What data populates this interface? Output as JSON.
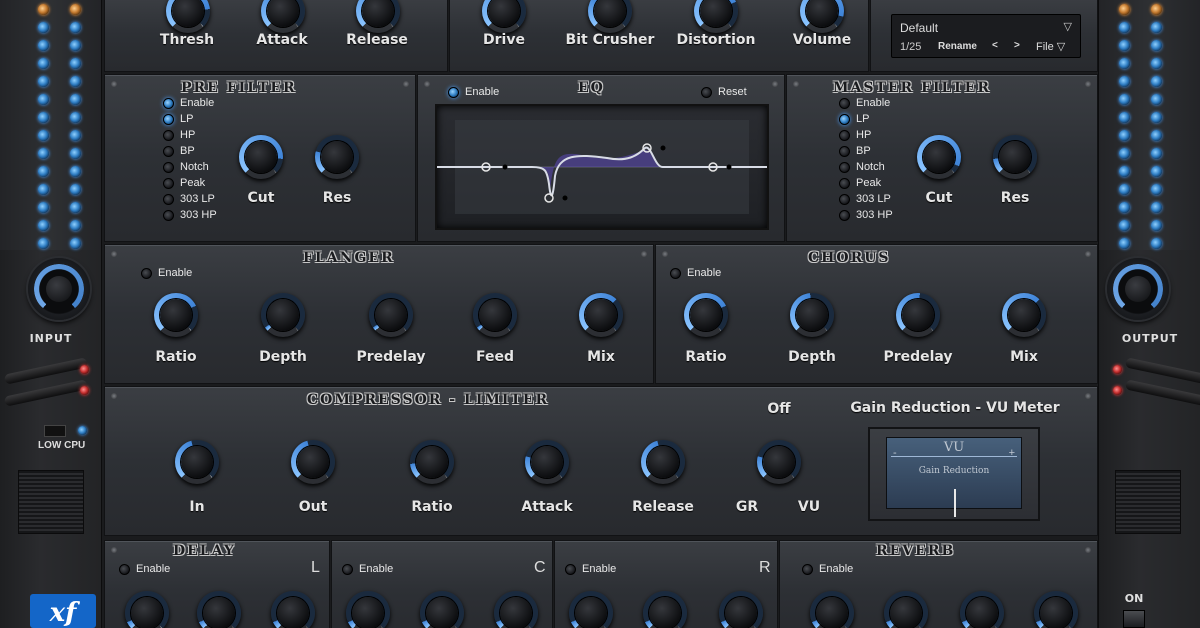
{
  "top_row": {
    "dynamics_labels": [
      "Thresh",
      "Attack",
      "Release"
    ],
    "fx_labels": [
      "Drive",
      "Bit Crusher",
      "Distortion",
      "Volume"
    ]
  },
  "preset": {
    "name": "Default",
    "counter": "1/25",
    "rename": "Rename",
    "prev": "<",
    "next": ">",
    "file": "File"
  },
  "pre_filter": {
    "title": "PRE FILTER",
    "options": [
      "Enable",
      "LP",
      "HP",
      "BP",
      "Notch",
      "Peak",
      "303 LP",
      "303 HP"
    ],
    "active": [
      true,
      true,
      false,
      false,
      false,
      false,
      false,
      false
    ],
    "knobs": [
      "Cut",
      "Res"
    ]
  },
  "eq": {
    "title": "EQ",
    "enable": "Enable",
    "reset": "Reset"
  },
  "master_filter": {
    "title": "MASTER FILTER",
    "options": [
      "Enable",
      "LP",
      "HP",
      "BP",
      "Notch",
      "Peak",
      "303 LP",
      "303 HP"
    ],
    "active": [
      false,
      true,
      false,
      false,
      false,
      false,
      false,
      false
    ],
    "knobs": [
      "Cut",
      "Res"
    ]
  },
  "flanger": {
    "title": "FLANGER",
    "enable": "Enable",
    "knobs": [
      "Ratio",
      "Depth",
      "Predelay",
      "Feed",
      "Mix"
    ]
  },
  "chorus": {
    "title": "CHORUS",
    "enable": "Enable",
    "knobs": [
      "Ratio",
      "Depth",
      "Predelay",
      "Mix"
    ]
  },
  "compressor": {
    "title": "COMPRESSOR - LIMITER",
    "knobs": [
      "In",
      "Out",
      "Ratio",
      "Attack",
      "Release"
    ],
    "gr_label": "GR",
    "vu_label": "VU",
    "mode": "Off",
    "vu_meter_title": "Gain Reduction - VU Meter",
    "vu_face_title": "VU",
    "vu_face_sub": "Gain Reduction",
    "vu_minus": "-",
    "vu_plus": "+"
  },
  "delay": {
    "title": "DELAY",
    "enable": "Enable",
    "channels": [
      "L",
      "C",
      "R"
    ]
  },
  "reverb": {
    "title": "REVERB",
    "enable": "Enable"
  },
  "left_rail": {
    "label": "INPUT",
    "low_cpu": "LOW CPU"
  },
  "right_rail": {
    "label": "OUTPUT",
    "power": "ON"
  },
  "logo": "xf",
  "colors": {
    "accent_blue": "#4aa0ff",
    "panel": "#2f3237",
    "label_text": "#e6e6e6"
  }
}
